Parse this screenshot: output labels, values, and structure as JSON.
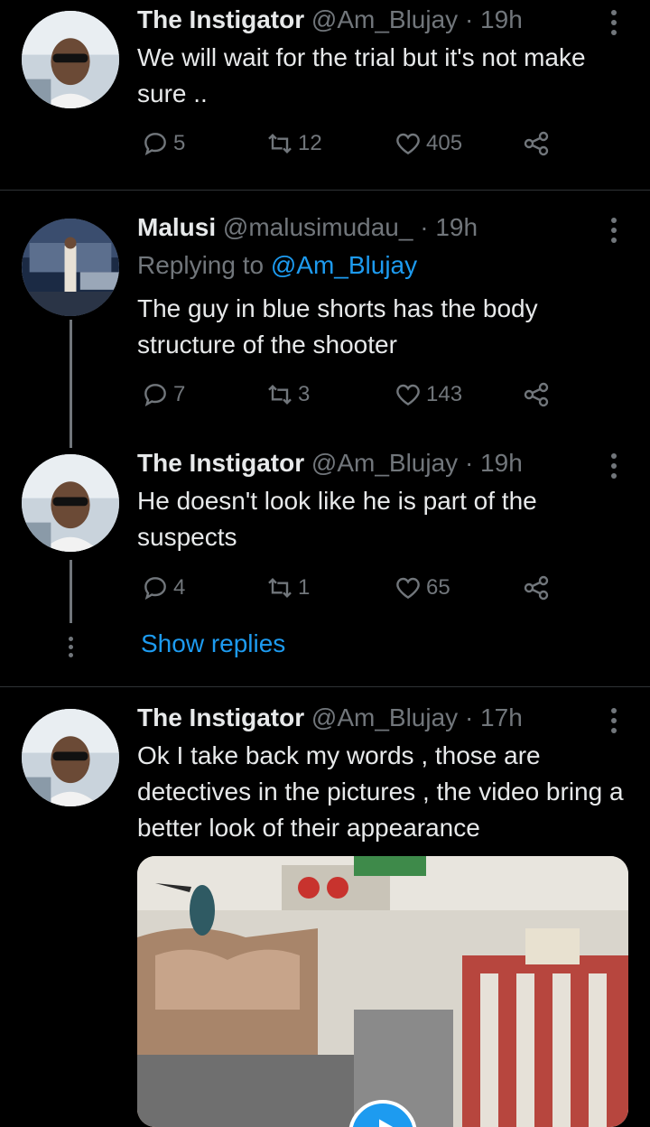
{
  "tweets": [
    {
      "name": "The Instigator",
      "meta": "@Am_Blujay · 19h",
      "text": "We will wait for the trial but it's not make sure ..",
      "replies": "5",
      "retweets": "12",
      "likes": "405"
    },
    {
      "name": "Malusi",
      "meta": "@malusimudau_ · 19h",
      "replying_prefix": "Replying to",
      "replying_handle": "@Am_Blujay",
      "text": "The guy in blue shorts has the body structure of the shooter",
      "replies": "7",
      "retweets": "3",
      "likes": "143"
    },
    {
      "name": "The Instigator",
      "meta": "@Am_Blujay · 19h",
      "text": "He doesn't look like he is part of the suspects",
      "replies": "4",
      "retweets": "1",
      "likes": "65"
    },
    {
      "name": "The Instigator",
      "meta": "@Am_Blujay · 17h",
      "text": "Ok I take back my words , those are detectives in the pictures , the video bring a better look of their appearance"
    }
  ],
  "show_replies": "Show replies",
  "icons": {
    "reply": "reply-icon",
    "retweet": "retweet-icon",
    "like": "heart-icon",
    "share": "share-icon",
    "more": "more-icon",
    "play": "play-icon"
  },
  "colors": {
    "background": "#000000",
    "text": "#e7e9ea",
    "muted": "#71767b",
    "accent": "#1d9bf0"
  }
}
